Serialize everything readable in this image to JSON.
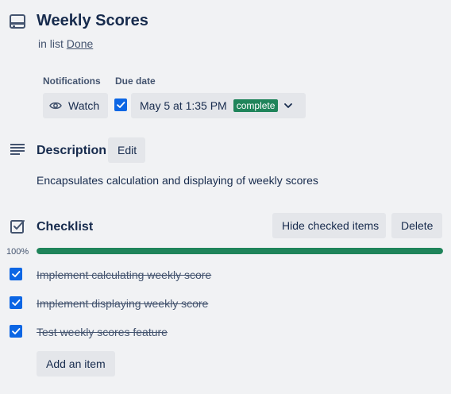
{
  "card": {
    "title": "Weekly Scores",
    "in_list_prefix": "in list",
    "list_name": "Done"
  },
  "notifications": {
    "label": "Notifications",
    "watch_label": "Watch"
  },
  "due_date": {
    "label": "Due date",
    "checked": true,
    "value": "May 5 at 1:35 PM",
    "badge": "complete",
    "badge_color": "#1f845a"
  },
  "description": {
    "title": "Description",
    "edit_label": "Edit",
    "text": "Encapsulates calculation and displaying of weekly scores"
  },
  "checklist": {
    "title": "Checklist",
    "hide_checked_label": "Hide checked items",
    "delete_label": "Delete",
    "progress_label": "100%",
    "progress_fraction": 1.0,
    "progress_color": "#1f845a",
    "items": [
      {
        "text": "Implement calculating weekly score",
        "checked": true
      },
      {
        "text": "Implement displaying weekly score",
        "checked": true
      },
      {
        "text": "Test weekly scores feature",
        "checked": true
      }
    ],
    "add_item_label": "Add an item"
  },
  "colors": {
    "accent": "#0c66e4",
    "background": "#f1f2f4"
  }
}
